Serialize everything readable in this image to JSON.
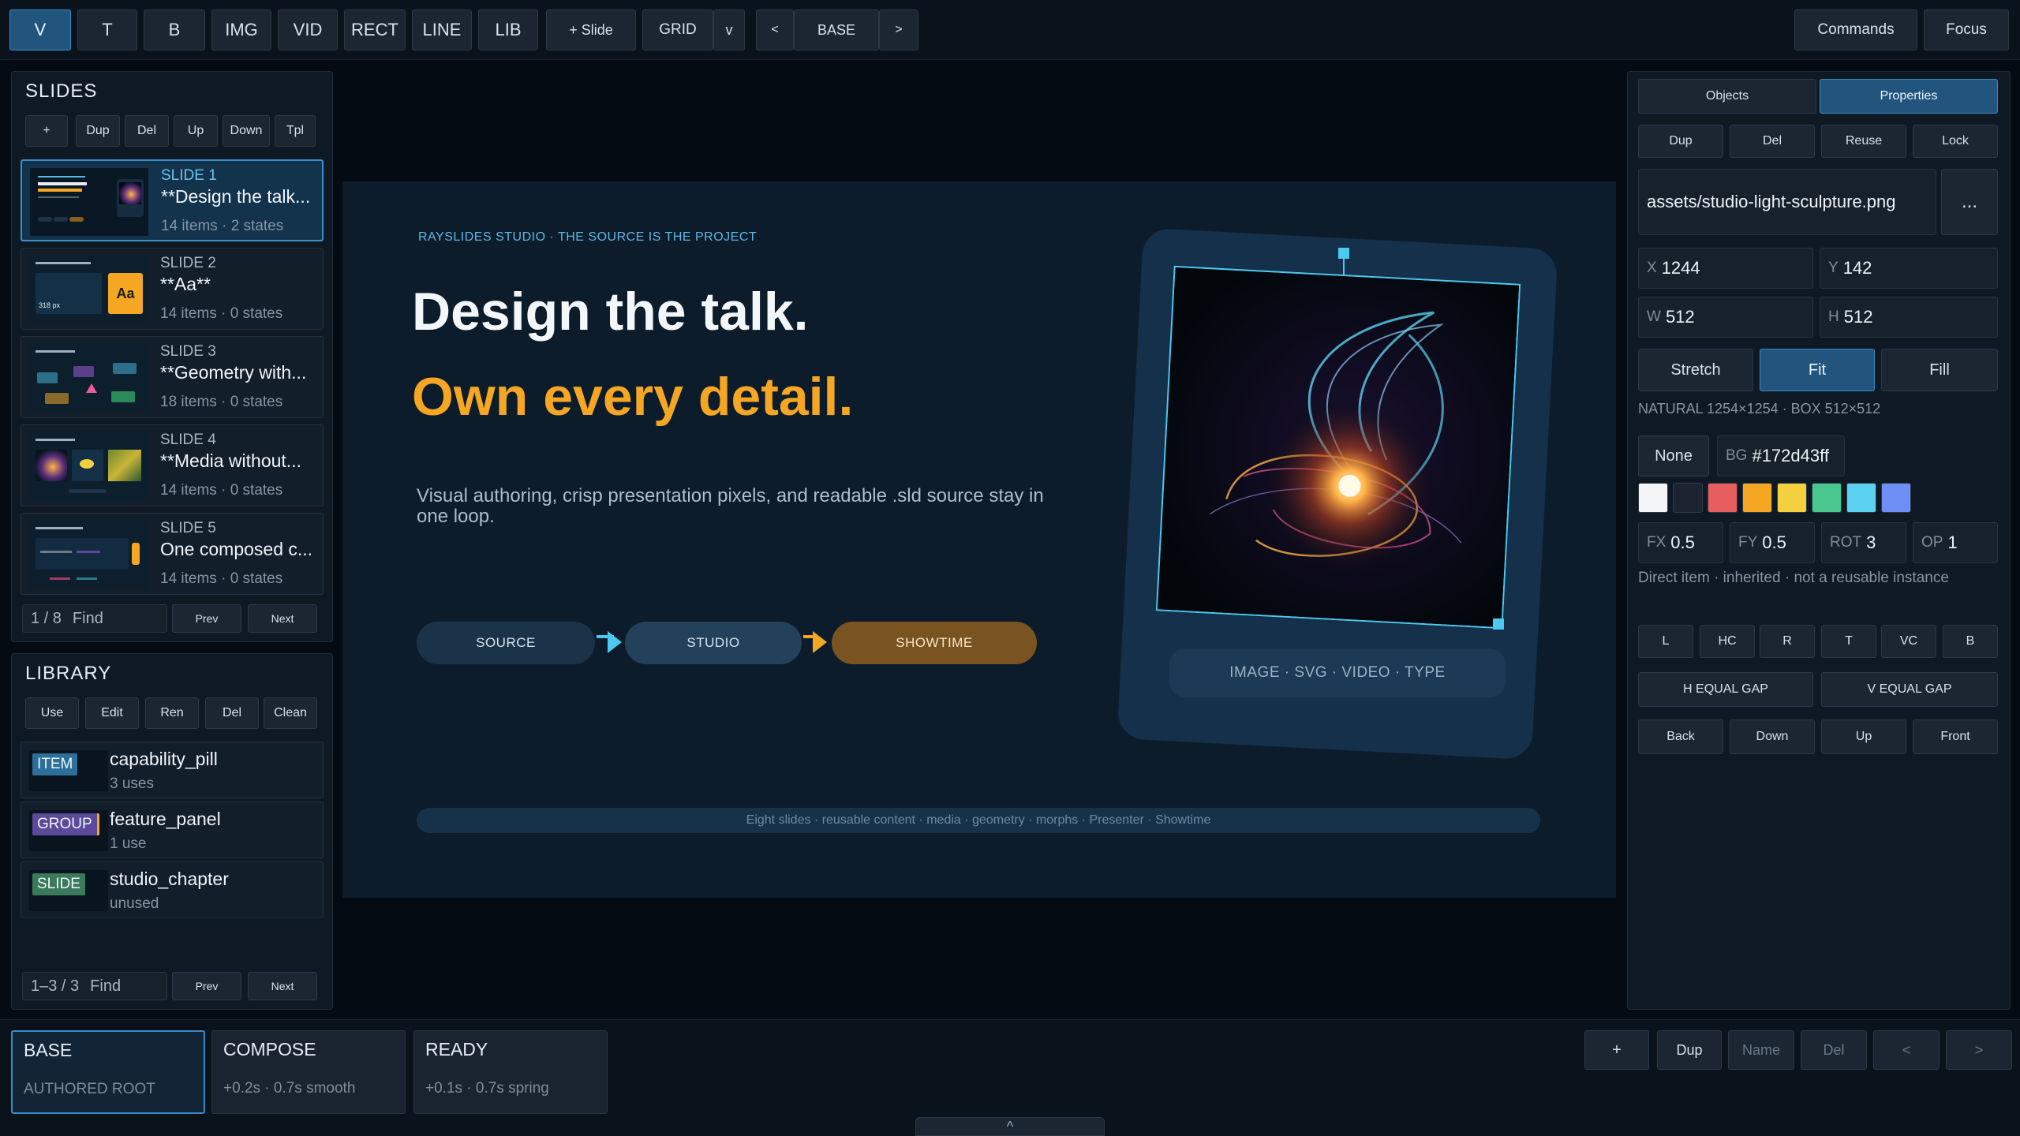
{
  "toolbar": {
    "tools": [
      "V",
      "T",
      "B",
      "IMG",
      "VID",
      "RECT",
      "LINE",
      "LIB"
    ],
    "add_slide": "+ Slide",
    "grid": "GRID",
    "grid_dropdown": "v",
    "prev": "<",
    "state_name": "BASE",
    "next": ">",
    "commands": "Commands",
    "focus": "Focus"
  },
  "slides_panel": {
    "title": "SLIDES",
    "actions": [
      "+",
      "Dup",
      "Del",
      "Up",
      "Down",
      "Tpl"
    ],
    "items": [
      {
        "num": "SLIDE 1",
        "title": "**Design the talk...",
        "meta": "14 items · 2 states"
      },
      {
        "num": "SLIDE 2",
        "title": "**Aa**",
        "meta": "14 items · 0 states"
      },
      {
        "num": "SLIDE 3",
        "title": "**Geometry with...",
        "meta": "18 items · 0 states"
      },
      {
        "num": "SLIDE 4",
        "title": "**Media without...",
        "meta": "14 items · 0 states"
      },
      {
        "num": "SLIDE 5",
        "title": "One composed c...",
        "meta": "14 items · 0 states"
      }
    ],
    "thumb2_label": "Aa",
    "thumb2_text": "318 px",
    "pager": "1 / 8",
    "find": "Find",
    "prev": "Prev",
    "next": "Next"
  },
  "library_panel": {
    "title": "LIBRARY",
    "actions": [
      "Use",
      "Edit",
      "Ren",
      "Del",
      "Clean"
    ],
    "items": [
      {
        "badge": "ITEM",
        "name": "capability_pill",
        "meta": "3 uses"
      },
      {
        "badge": "GROUP",
        "name": "feature_panel",
        "meta": "1 use"
      },
      {
        "badge": "SLIDE",
        "name": "studio_chapter",
        "meta": "unused"
      }
    ],
    "pager": "1–3 / 3",
    "find": "Find",
    "prev": "Prev",
    "next": "Next"
  },
  "canvas": {
    "eyebrow": "RAYSLIDES STUDIO · THE SOURCE IS THE PROJECT",
    "headline1": "Design the talk.",
    "headline2": "Own every detail.",
    "body": "Visual authoring, crisp presentation pixels, and readable .sld source stay in one loop.",
    "pills": [
      "SOURCE",
      "STUDIO",
      "SHOWTIME"
    ],
    "media_caption": "IMAGE · SVG · VIDEO · TYPE",
    "footer": "Eight slides · reusable content · media · geometry · morphs · Presenter · Showtime"
  },
  "inspector": {
    "tabs": [
      "Objects",
      "Properties"
    ],
    "actions": [
      "Dup",
      "Del",
      "Reuse",
      "Lock"
    ],
    "path": "assets/studio-light-sculpture.png",
    "more": "...",
    "x_label": "X",
    "x": "1244",
    "y_label": "Y",
    "y": "142",
    "w_label": "W",
    "w": "512",
    "h_label": "H",
    "h": "512",
    "fit_modes": [
      "Stretch",
      "Fit",
      "Fill"
    ],
    "natural": "NATURAL 1254×1254 · BOX 512×512",
    "none": "None",
    "bg_label": "BG",
    "bg": "#172d43ff",
    "swatches": [
      "#f3f5f7",
      "#1b2430",
      "#e85d5d",
      "#f5a623",
      "#f4d03f",
      "#48c78e",
      "#5ad1f0",
      "#6f8ff7"
    ],
    "fx_label": "FX",
    "fx": "0.5",
    "fy_label": "FY",
    "fy": "0.5",
    "rot_label": "ROT",
    "rot": "3",
    "op_label": "OP",
    "op": "1",
    "inherit_note": "Direct item · inherited · not a reusable instance",
    "align": [
      "L",
      "HC",
      "R",
      "T",
      "VC",
      "B"
    ],
    "h_gap": "H EQUAL GAP",
    "v_gap": "V EQUAL GAP",
    "order": [
      "Back",
      "Down",
      "Up",
      "Front"
    ]
  },
  "states": {
    "cards": [
      {
        "name": "BASE",
        "sub": "AUTHORED ROOT"
      },
      {
        "name": "COMPOSE",
        "sub": "+0.2s · 0.7s smooth"
      },
      {
        "name": "READY",
        "sub": "+0.1s · 0.7s spring"
      }
    ],
    "actions": [
      "+",
      "Dup",
      "Name",
      "Del",
      "<",
      ">"
    ],
    "collapse": "^"
  },
  "colors": {
    "accent": "#3a8ac4",
    "orange": "#f5a623",
    "cyan": "#4cc9f0"
  }
}
